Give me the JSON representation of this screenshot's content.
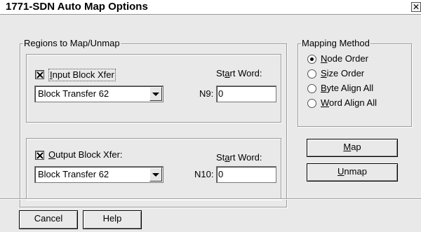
{
  "window": {
    "title": "1771-SDN Auto Map Options",
    "close_glyph": "✕"
  },
  "regions": {
    "legend": "Regions to Map/Unmap",
    "input": {
      "checkbox_label": "Input Block Xfer",
      "checked": true,
      "start_word_label": "Start Word:",
      "combo_value": "Block Transfer 62",
      "file_prefix": "N9:",
      "start_word_value": "0"
    },
    "output": {
      "checkbox_label": "Output Block Xfer:",
      "checked": true,
      "start_word_label": "Start Word:",
      "combo_value": "Block Transfer 62",
      "file_prefix": "N10:",
      "start_word_value": "0"
    }
  },
  "mapping": {
    "legend": "Mapping Method",
    "options": [
      {
        "label": "Node Order",
        "selected": true
      },
      {
        "label": "Size Order",
        "selected": false
      },
      {
        "label": "Byte Align All",
        "selected": false
      },
      {
        "label": "Word Align All",
        "selected": false
      }
    ]
  },
  "buttons": {
    "map": "Map",
    "unmap": "Unmap",
    "cancel": "Cancel",
    "help": "Help"
  }
}
